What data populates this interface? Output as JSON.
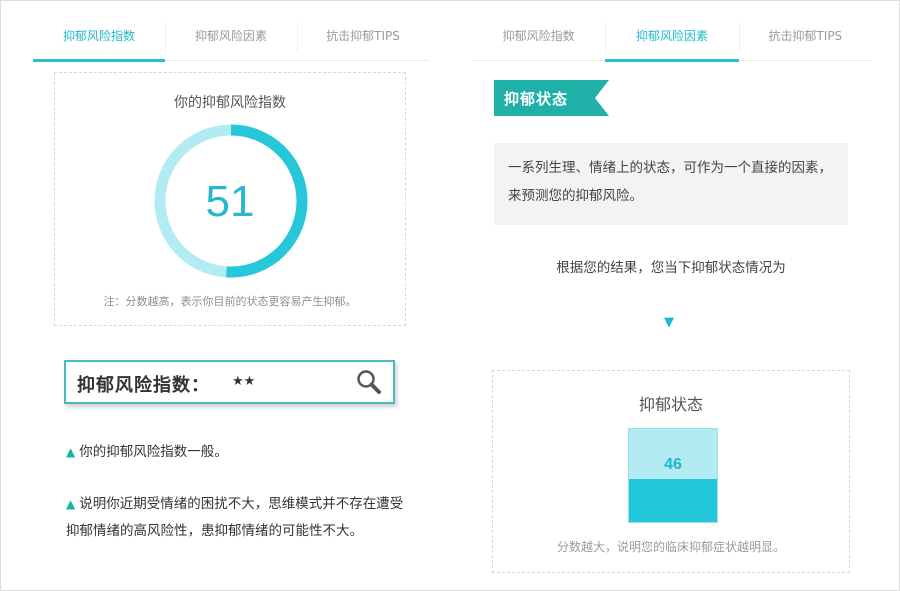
{
  "left_tabs": [
    {
      "label": "抑郁风险指数",
      "active": true
    },
    {
      "label": "抑郁风险因素",
      "active": false
    },
    {
      "label": "抗击抑郁TIPS",
      "active": false
    }
  ],
  "right_tabs": [
    {
      "label": "抑郁风险指数",
      "active": false
    },
    {
      "label": "抑郁风险因素",
      "active": true
    },
    {
      "label": "抗击抑郁TIPS",
      "active": false
    }
  ],
  "gauge": {
    "title": "你的抑郁风险指数",
    "value": "51",
    "fraction": 0.51,
    "note": "注：分数越高，表示你目前的状态更容易产生抑郁。",
    "track_color": "#b3ebf2",
    "fill_color": "#27c7da"
  },
  "search_box": {
    "label": "抑郁风险指数：",
    "stars": "★★",
    "icon": "magnifier-icon"
  },
  "paragraphs": [
    {
      "bullet": "▲",
      "text": "你的抑郁风险指数一般。"
    },
    {
      "bullet": "▲",
      "text": "说明你近期受情绪的困扰不大，思维模式并不存在遭受抑郁情绪的高风险性，患抑郁情绪的可能性不大。"
    }
  ],
  "ribbon": {
    "label": "抑郁状态",
    "color": "#1fb1a8"
  },
  "description": "一系列生理、情绪上的状态，可作为一个直接的因素，来预测您的抑郁风险。",
  "result_line": "根据您的结果，您当下抑郁状态情况为",
  "arrow": "▼",
  "status_card": {
    "title": "抑郁状态",
    "value": "46",
    "fill_fraction": 0.46,
    "note": "分数越大，说明您的临床抑郁症状越明显。",
    "accent": "#23c6da"
  }
}
